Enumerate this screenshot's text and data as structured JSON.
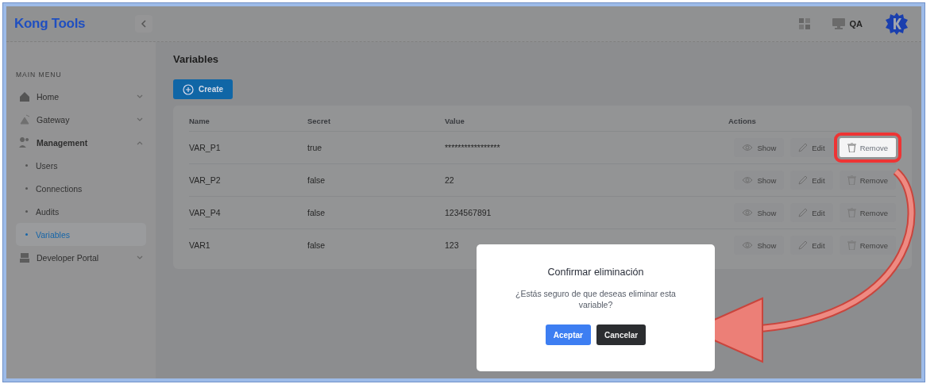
{
  "brand": "Kong Tools",
  "header": {
    "environment": "QA"
  },
  "sidebar": {
    "section_title": "MAIN MENU",
    "items": [
      {
        "label": "Home",
        "expanded": false
      },
      {
        "label": "Gateway",
        "expanded": false
      },
      {
        "label": "Management",
        "expanded": true,
        "children": [
          {
            "label": "Users",
            "selected": false
          },
          {
            "label": "Connections",
            "selected": false
          },
          {
            "label": "Audits",
            "selected": false
          },
          {
            "label": "Variables",
            "selected": true
          }
        ]
      },
      {
        "label": "Developer Portal",
        "expanded": false
      }
    ]
  },
  "page_title": "Variables",
  "create_button": "Create",
  "table": {
    "columns": [
      "Name",
      "Secret",
      "Value",
      "Actions"
    ],
    "rows": [
      {
        "name": "VAR_P1",
        "secret": "true",
        "value": "*****************",
        "show": "Show",
        "edit": "Edit",
        "remove": "Remove",
        "highlighted": true
      },
      {
        "name": "VAR_P2",
        "secret": "false",
        "value": "22",
        "show": "Show",
        "edit": "Edit",
        "remove": "Remove",
        "highlighted": false
      },
      {
        "name": "VAR_P4",
        "secret": "false",
        "value": "1234567891",
        "show": "Show",
        "edit": "Edit",
        "remove": "Remove",
        "highlighted": false
      },
      {
        "name": "VAR1",
        "secret": "false",
        "value": "123",
        "show": "Show",
        "edit": "Edit",
        "remove": "Remove",
        "highlighted": false
      }
    ]
  },
  "dialog": {
    "title": "Confirmar eliminación",
    "message": "¿Estás seguro de que deseas eliminar esta variable?",
    "accept": "Aceptar",
    "cancel": "Cancelar"
  }
}
